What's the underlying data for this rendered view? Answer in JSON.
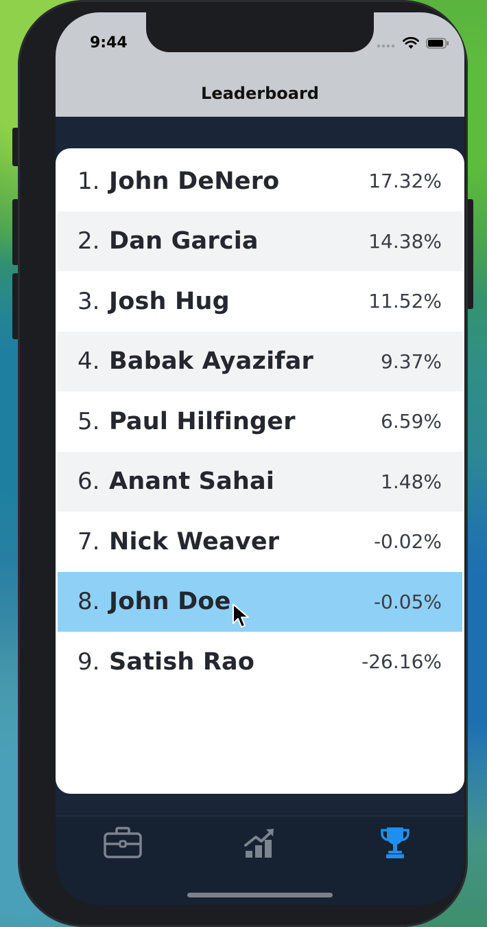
{
  "status_bar": {
    "time": "9:44"
  },
  "nav": {
    "title": "Leaderboard"
  },
  "leaderboard": {
    "rows": [
      {
        "rank": "1.",
        "name": "John DeNero",
        "pct": "17.32%"
      },
      {
        "rank": "2.",
        "name": "Dan Garcia",
        "pct": "14.38%"
      },
      {
        "rank": "3.",
        "name": "Josh Hug",
        "pct": "11.52%"
      },
      {
        "rank": "4.",
        "name": "Babak Ayazifar",
        "pct": "9.37%"
      },
      {
        "rank": "5.",
        "name": "Paul Hilfinger",
        "pct": "6.59%"
      },
      {
        "rank": "6.",
        "name": "Anant Sahai",
        "pct": "1.48%"
      },
      {
        "rank": "7.",
        "name": "Nick Weaver",
        "pct": "-0.02%"
      },
      {
        "rank": "8.",
        "name": "John Doe",
        "pct": "-0.05%"
      },
      {
        "rank": "9.",
        "name": "Satish Rao",
        "pct": "-26.16%"
      }
    ],
    "selected_index": 7
  },
  "tab_bar": {
    "tabs": [
      {
        "icon": "briefcase-icon",
        "active": false
      },
      {
        "icon": "chart-growth-icon",
        "active": false
      },
      {
        "icon": "trophy-icon",
        "active": true
      }
    ],
    "active_color": "#1e8ff0",
    "inactive_color": "#7c8490"
  }
}
